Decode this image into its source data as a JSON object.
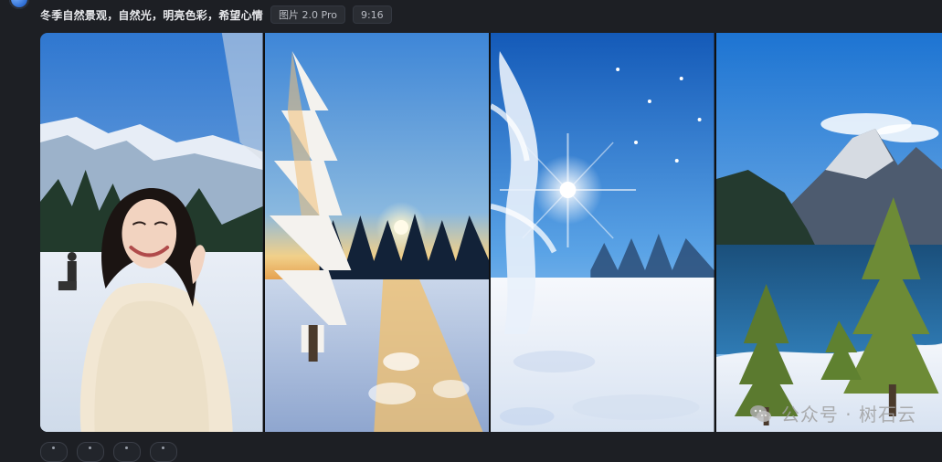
{
  "header": {
    "prompt": "冬季自然景观，自然光，明亮色彩，希望心情",
    "model_tag": "图片 2.0 Pro",
    "ratio_tag": "9:16"
  },
  "images": [
    {
      "name": "winter-portrait-woman"
    },
    {
      "name": "snowy-sunset-tree"
    },
    {
      "name": "frosted-sunburst-snowfield"
    },
    {
      "name": "alpine-lake-mountains"
    }
  ],
  "watermark": {
    "text": "公众号 · 树石云"
  },
  "toolbar": {
    "buttons": [
      "tool-1",
      "tool-2",
      "tool-3",
      "tool-4"
    ]
  },
  "colors": {
    "background": "#1d1f24",
    "tag_bg": "#2a2d33"
  }
}
